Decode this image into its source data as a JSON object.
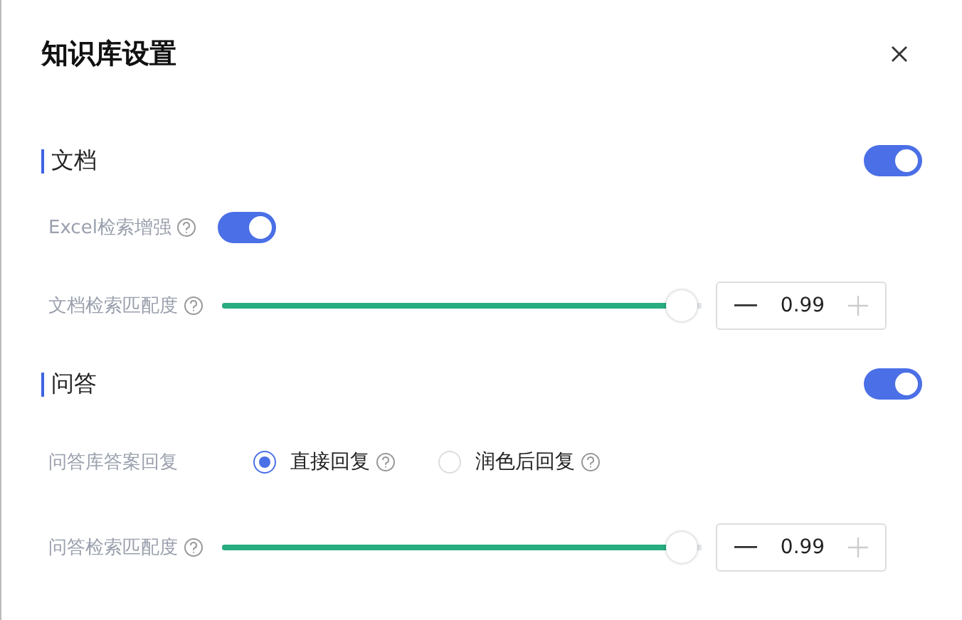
{
  "dialog": {
    "title": "知识库设置"
  },
  "sections": [
    {
      "title": "文档",
      "on": true,
      "rows": [
        {
          "kind": "toggle",
          "label": "Excel检索增强",
          "help": true,
          "on": true
        },
        {
          "kind": "slider",
          "label": "文档检索匹配度",
          "help": true,
          "level": 0.99,
          "value": "0.99",
          "minus_disabled": false,
          "plus_disabled": true
        }
      ]
    },
    {
      "title": "问答",
      "on": true,
      "rows": [
        {
          "kind": "radio",
          "label": "问答库答案回复",
          "help": false,
          "options": [
            {
              "label": "直接回复",
              "selected": true,
              "help": true
            },
            {
              "label": "润色后回复",
              "selected": false,
              "help": true
            }
          ]
        },
        {
          "kind": "slider",
          "label": "问答检索匹配度",
          "help": true,
          "level": 0.99,
          "value": "0.99",
          "minus_disabled": false,
          "plus_disabled": true
        }
      ]
    }
  ]
}
